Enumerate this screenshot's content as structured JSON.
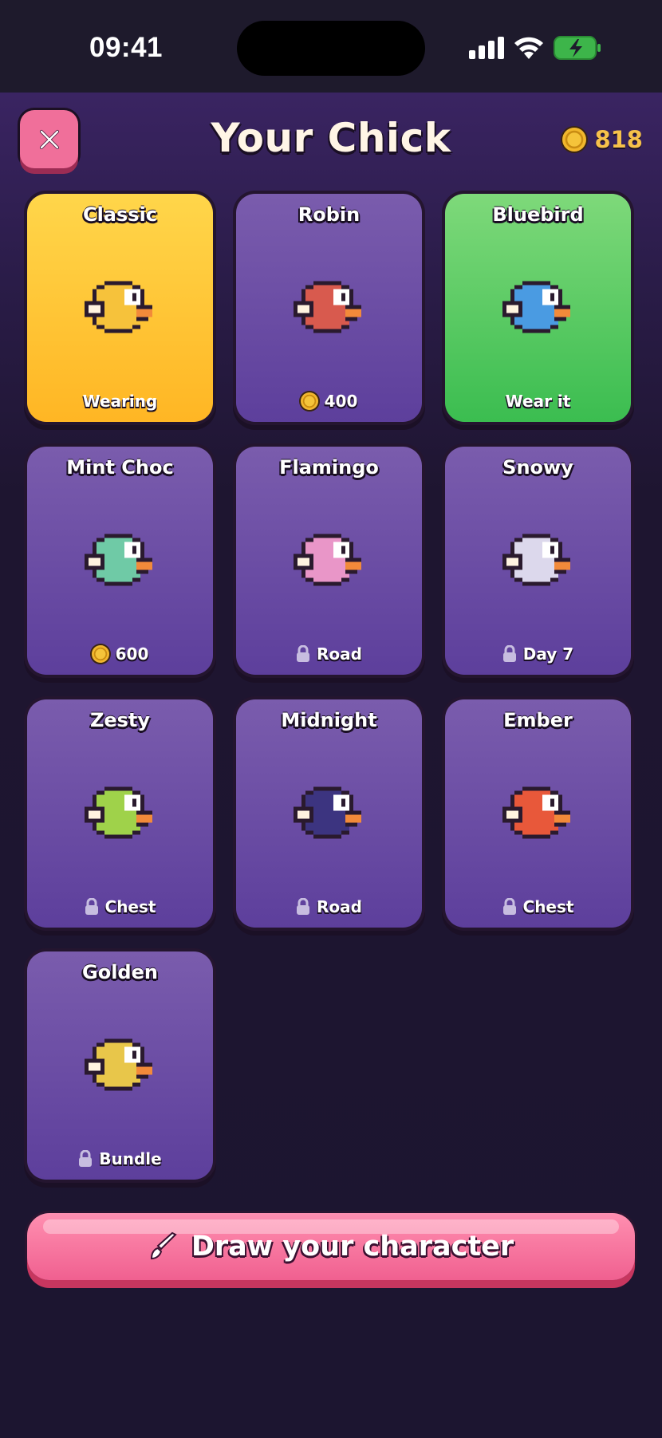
{
  "status_bar": {
    "time": "09:41"
  },
  "header": {
    "title": "Your Chick",
    "coins": "818"
  },
  "characters": [
    {
      "name": "Classic",
      "footer": "Wearing",
      "footer_type": "text",
      "color": "#f6c23b"
    },
    {
      "name": "Robin",
      "footer": "400",
      "footer_type": "coin",
      "color": "#d85a4e"
    },
    {
      "name": "Bluebird",
      "footer": "Wear it",
      "footer_type": "text",
      "color": "#4a9be2"
    },
    {
      "name": "Mint Choc",
      "footer": "600",
      "footer_type": "coin",
      "color": "#6fcaa6"
    },
    {
      "name": "Flamingo",
      "footer": "Road",
      "footer_type": "lock",
      "color": "#e996c8"
    },
    {
      "name": "Snowy",
      "footer": "Day 7",
      "footer_type": "lock",
      "color": "#dcd8ec"
    },
    {
      "name": "Zesty",
      "footer": "Chest",
      "footer_type": "lock",
      "color": "#9fd24a"
    },
    {
      "name": "Midnight",
      "footer": "Road",
      "footer_type": "lock",
      "color": "#3c3480"
    },
    {
      "name": "Ember",
      "footer": "Chest",
      "footer_type": "lock",
      "color": "#e8583a"
    },
    {
      "name": "Golden",
      "footer": "Bundle",
      "footer_type": "lock",
      "color": "#e8c64a"
    }
  ],
  "draw_button": {
    "label": "Draw your character"
  }
}
